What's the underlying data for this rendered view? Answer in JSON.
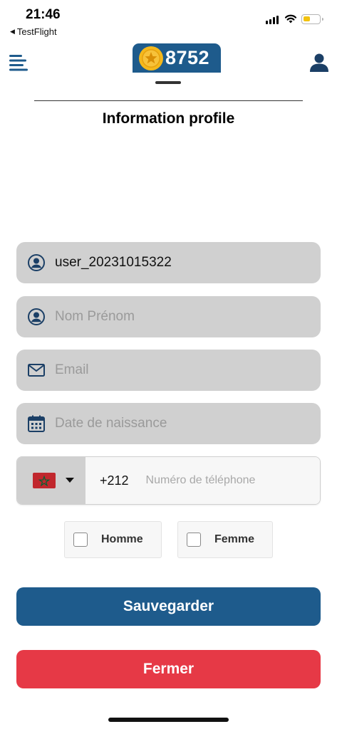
{
  "status_bar": {
    "time": "21:46",
    "back_app": "TestFlight",
    "battery_color": "#f2c20f"
  },
  "header": {
    "coins": "8752",
    "brand_color": "#1e5b8c"
  },
  "page_title": "Information profile",
  "form": {
    "username": {
      "value": "user_20231015322",
      "icon": "user-circle-icon"
    },
    "full_name": {
      "value": "",
      "placeholder": "Nom Prénom",
      "icon": "user-circle-icon"
    },
    "email": {
      "value": "",
      "placeholder": "Email",
      "icon": "envelope-icon"
    },
    "birth_date": {
      "value": "",
      "placeholder": "Date de naissance",
      "icon": "calendar-icon"
    },
    "phone": {
      "country_flag": "morocco-flag",
      "dial_code": "+212",
      "value": "",
      "placeholder": "Numéro de téléphone"
    },
    "gender": {
      "options": [
        {
          "label": "Homme",
          "checked": false
        },
        {
          "label": "Femme",
          "checked": false
        }
      ]
    }
  },
  "actions": {
    "save_label": "Sauvegarder",
    "save_color": "#1e5b8c",
    "close_label": "Fermer",
    "close_color": "#e63946"
  }
}
